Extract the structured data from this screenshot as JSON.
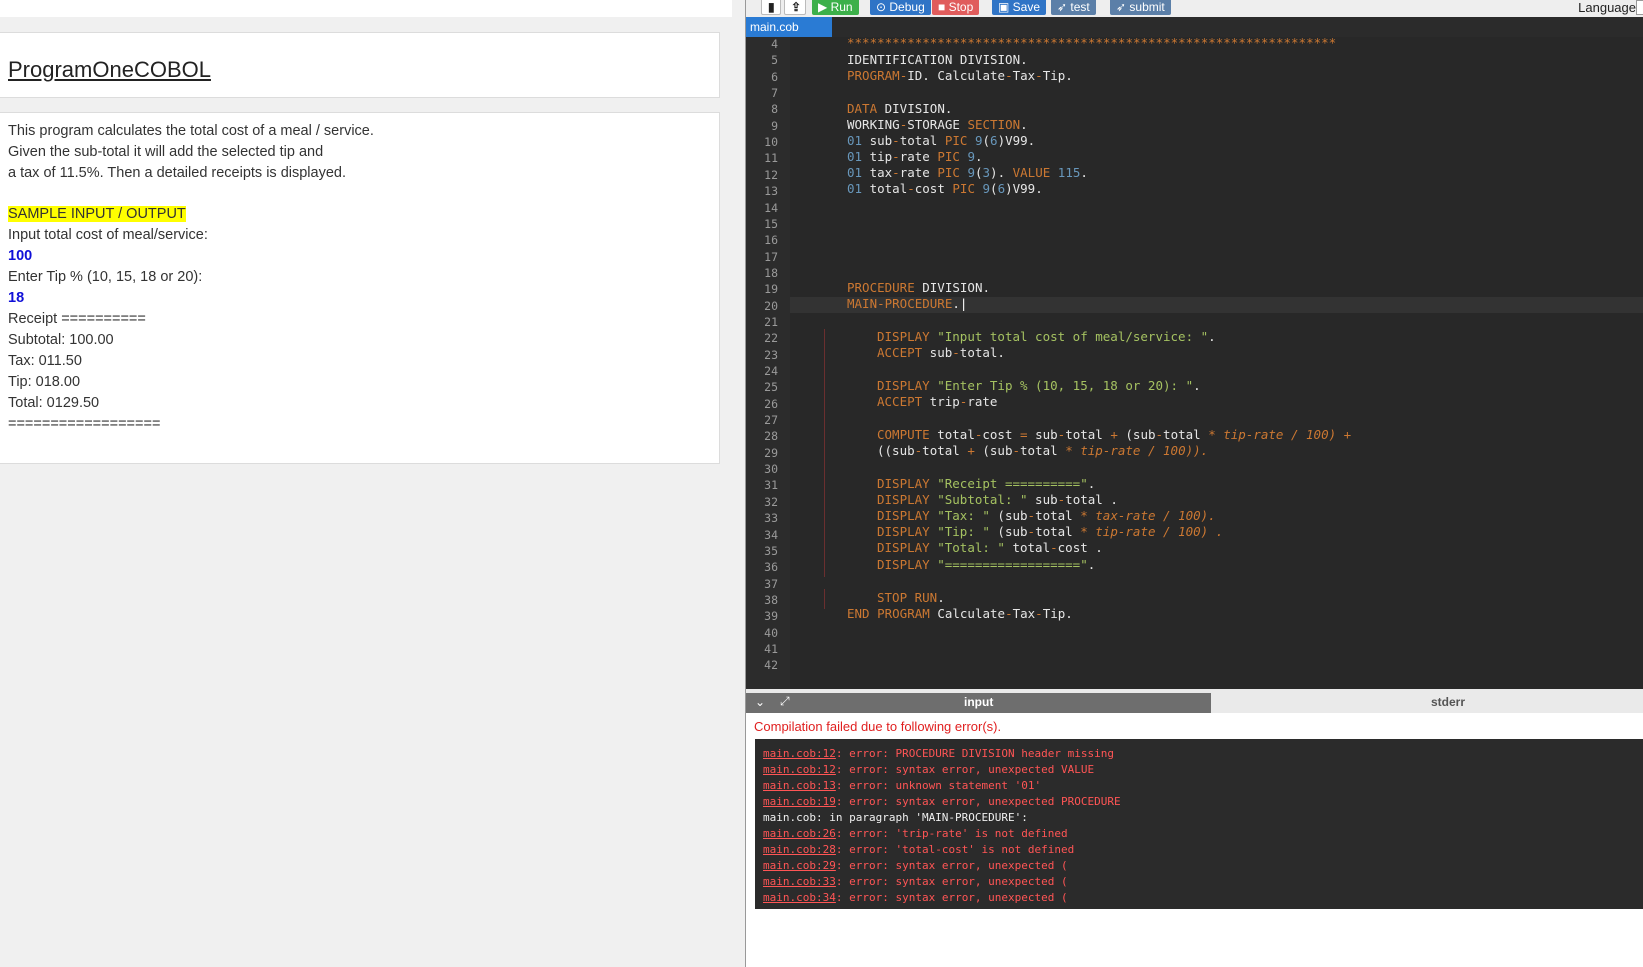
{
  "problem": {
    "title": "ProgramOneCOBOL",
    "description": [
      "This program calculates the total cost of a meal / service.",
      "Given the sub-total it will add the selected tip and",
      "a tax of 11.5%.  Then a detailed receipts is displayed."
    ],
    "sample_heading": "SAMPLE INPUT / OUTPUT",
    "sample_lines": [
      "Input total cost of meal/service:",
      "100",
      "Enter Tip % (10, 15, 18 or 20):",
      "18",
      "Receipt ==========",
      "Subtotal: 100.00",
      "Tax: 011.50",
      "Tip: 018.00",
      "Total: 0129.50",
      "=================="
    ]
  },
  "toolbar": {
    "new_icon": "file-icon",
    "upload_icon": "upload-icon",
    "run": "▶ Run",
    "debug": "⊙ Debug",
    "stop": "■ Stop",
    "save": "▣ Save",
    "test": "➶ test",
    "submit": "➶ submit",
    "language": "Language"
  },
  "editor": {
    "file_tab": "main.cob",
    "line_numbers": [
      "4",
      "5",
      "6",
      "7",
      "8",
      "9",
      "10",
      "11",
      "12",
      "13",
      "14",
      "15",
      "16",
      "17",
      "18",
      "19",
      "20",
      "21",
      "22",
      "23",
      "24",
      "25",
      "26",
      "27",
      "28",
      "29",
      "30",
      "31",
      "32",
      "33",
      "34",
      "35",
      "36",
      "37",
      "38",
      "39",
      "40",
      "41",
      "42"
    ]
  },
  "io": {
    "input_tab": "input",
    "stderr_tab": "stderr",
    "error_heading": "Compilation failed due to following error(s).",
    "errors": [
      {
        "loc": "main.cob:12",
        "msg": ": error: PROCEDURE DIVISION header missing"
      },
      {
        "loc": "main.cob:12",
        "msg": ": error: syntax error, unexpected VALUE"
      },
      {
        "loc": "main.cob:13",
        "msg": ": error: unknown statement '01'"
      },
      {
        "loc": "main.cob:19",
        "msg": ": error: syntax error, unexpected PROCEDURE"
      },
      {
        "loc": "",
        "msg": "main.cob: in paragraph 'MAIN-PROCEDURE':"
      },
      {
        "loc": "main.cob:26",
        "msg": ": error: 'trip-rate' is not defined"
      },
      {
        "loc": "main.cob:28",
        "msg": ": error: 'total-cost' is not defined"
      },
      {
        "loc": "main.cob:29",
        "msg": ": error: syntax error, unexpected ("
      },
      {
        "loc": "main.cob:33",
        "msg": ": error: syntax error, unexpected ("
      },
      {
        "loc": "main.cob:34",
        "msg": ": error: syntax error, unexpected ("
      }
    ]
  },
  "colors": {
    "keyword": "#cc7832",
    "string": "#a5c261",
    "number": "#6897bb",
    "error": "#ff5555",
    "highlight": "#ffff00"
  }
}
